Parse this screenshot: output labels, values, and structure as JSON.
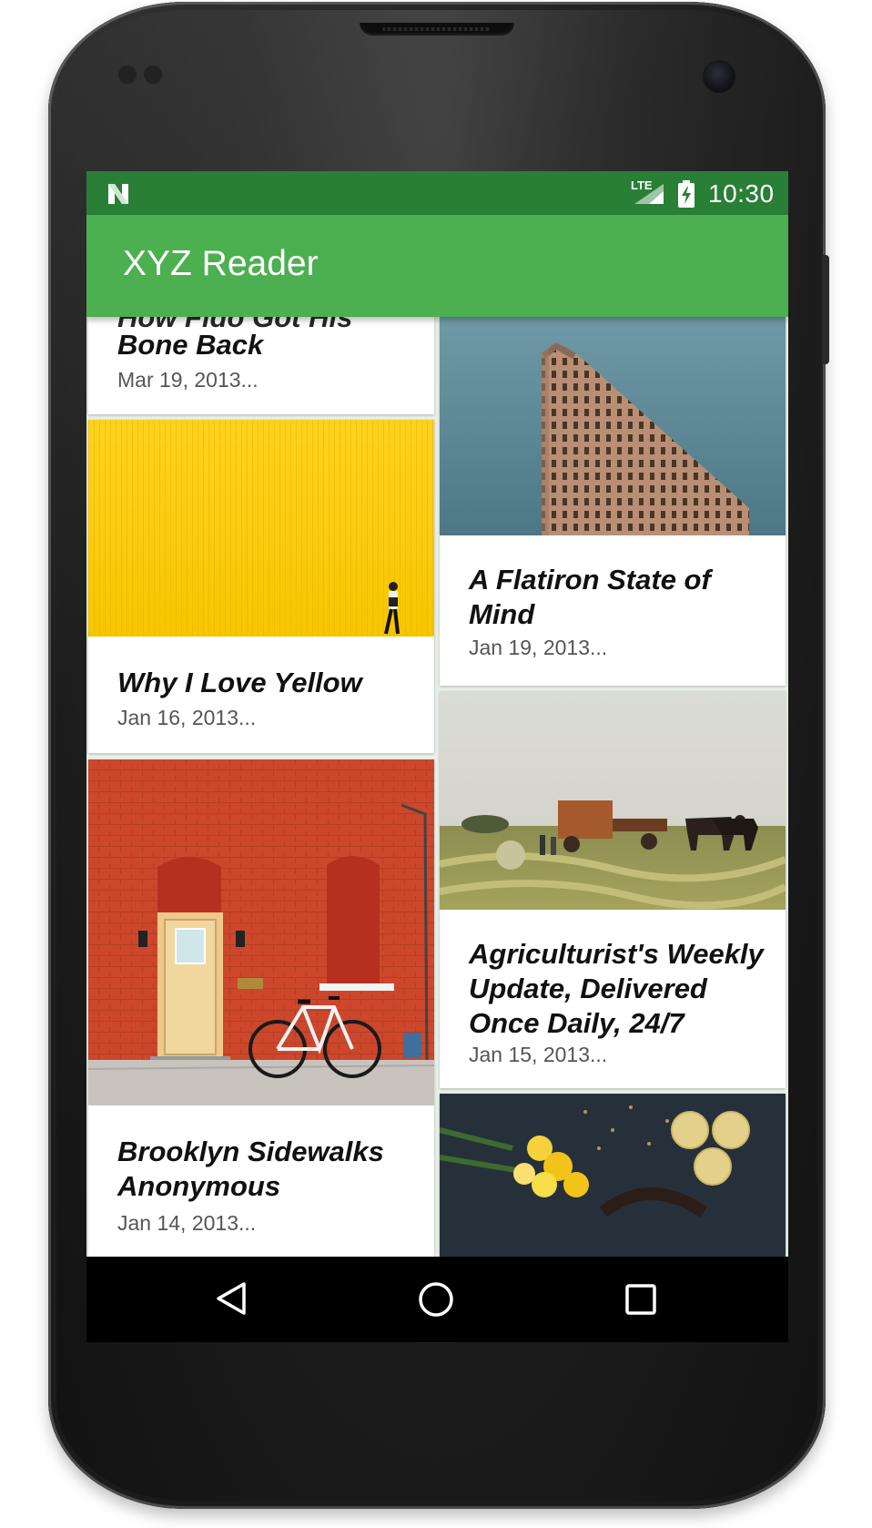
{
  "device": {
    "model": "Nexus 4"
  },
  "status_bar": {
    "network": "LTE",
    "time": "10:30",
    "icons": [
      "android-n-icon",
      "signal-icon",
      "battery-charging-icon"
    ]
  },
  "app_bar": {
    "title": "XYZ Reader"
  },
  "articles": [
    {
      "title": "How Fido Got His Bone Back",
      "title_visible": "Bone Back",
      "date": "Mar 19, 2013..."
    },
    {
      "title": "A Flatiron State of Mind",
      "date": "Jan 19, 2013..."
    },
    {
      "title": "Why I Love Yellow",
      "date": "Jan 16, 2013..."
    },
    {
      "title": "Agriculturist's Weekly Update, Delivered Once Daily, 24/7",
      "date": "Jan 15, 2013..."
    },
    {
      "title": "Brooklyn Sidewalks Anonymous",
      "date": "Jan 14, 2013..."
    }
  ],
  "nav_bar": {
    "buttons": [
      "back-icon",
      "home-icon",
      "recents-icon"
    ]
  },
  "colors": {
    "status_bar": "#2a7f36",
    "app_bar": "#4caf50",
    "background": "#e9f1e9"
  }
}
